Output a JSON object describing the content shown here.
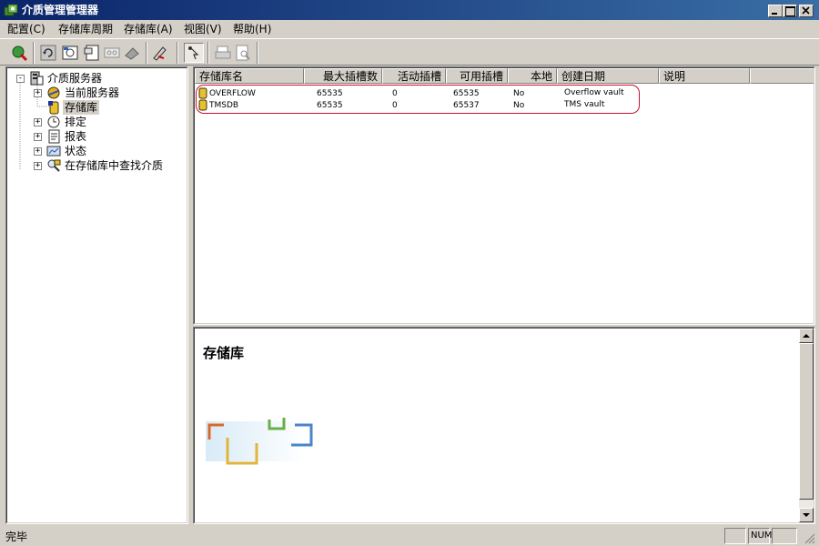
{
  "window": {
    "title": "介质管理管理器"
  },
  "menu": [
    {
      "label": "配置(C)"
    },
    {
      "label": "存储库周期"
    },
    {
      "label": "存储库(A)"
    },
    {
      "label": "视图(V)"
    },
    {
      "label": "帮助(H)"
    }
  ],
  "toolbar": {
    "buttons": [
      {
        "icon": "connect-icon",
        "enabled": true
      },
      {
        "icon": "refresh-icon",
        "enabled": true
      },
      {
        "icon": "media-icon",
        "enabled": true
      },
      {
        "icon": "properties-icon",
        "enabled": true
      },
      {
        "icon": "tape-icon",
        "enabled": false
      },
      {
        "icon": "eraser-icon",
        "enabled": false
      },
      {
        "icon": "edit-icon",
        "enabled": true
      },
      {
        "icon": "pointer-icon",
        "enabled": true
      },
      {
        "icon": "print-icon",
        "enabled": false
      },
      {
        "icon": "preview-icon",
        "enabled": false
      }
    ]
  },
  "tree": {
    "root": "介质服务器",
    "items": [
      {
        "label": "当前服务器",
        "icon": "server-icon",
        "expandable": true
      },
      {
        "label": "存储库",
        "icon": "vault-icon",
        "expandable": false,
        "selected": true
      },
      {
        "label": "排定",
        "icon": "schedule-icon",
        "expandable": true
      },
      {
        "label": "报表",
        "icon": "report-icon",
        "expandable": true
      },
      {
        "label": "状态",
        "icon": "status-icon",
        "expandable": true
      },
      {
        "label": "在存储库中查找介质",
        "icon": "find-media-icon",
        "expandable": true
      }
    ]
  },
  "list": {
    "columns": [
      "存储库名",
      "最大插槽数",
      "活动插槽",
      "可用插槽",
      "本地",
      "创建日期",
      "说明"
    ],
    "rows": [
      {
        "name": "OVERFLOW",
        "max_slots": "65535",
        "active_slots": "0",
        "available_slots": "65535",
        "local": "No",
        "created": "Overflow vault",
        "description": ""
      },
      {
        "name": "TMSDB",
        "max_slots": "65535",
        "active_slots": "0",
        "available_slots": "65537",
        "local": "No",
        "created": "TMS vault",
        "description": ""
      }
    ]
  },
  "detail": {
    "heading": "存储库"
  },
  "status": {
    "text": "完毕",
    "num": "NUM"
  },
  "colors": {
    "titlebar": "#0a246a",
    "face": "#d4d0c8",
    "highlight_ring": "#c8102e"
  }
}
